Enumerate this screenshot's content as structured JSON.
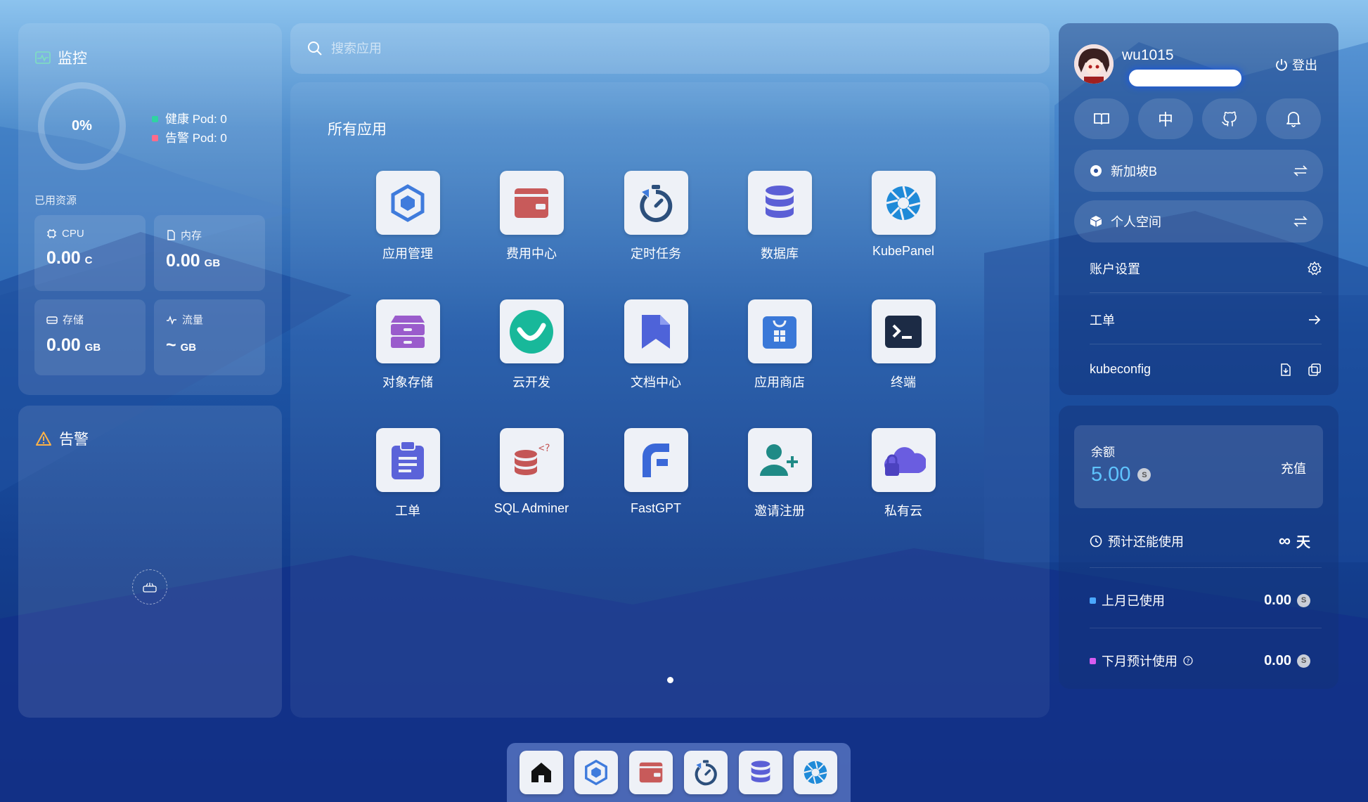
{
  "monitor": {
    "title": "监控",
    "percent": "0%",
    "healthy_pods": "健康 Pod: 0",
    "alert_pods": "告警 Pod: 0",
    "used_resources_label": "已用资源",
    "cpu": {
      "label": "CPU",
      "value": "0.00",
      "unit": "C"
    },
    "memory": {
      "label": "内存",
      "value": "0.00",
      "unit": "GB"
    },
    "storage": {
      "label": "存储",
      "value": "0.00",
      "unit": "GB"
    },
    "traffic": {
      "label": "流量",
      "value": "~",
      "unit": "GB"
    }
  },
  "alerts": {
    "title": "告警"
  },
  "search": {
    "placeholder": "搜索应用"
  },
  "apps": {
    "title": "所有应用",
    "items": [
      {
        "label": "应用管理",
        "icon": "app-management-icon"
      },
      {
        "label": "费用中心",
        "icon": "wallet-icon"
      },
      {
        "label": "定时任务",
        "icon": "timer-icon"
      },
      {
        "label": "数据库",
        "icon": "database-icon"
      },
      {
        "label": "KubePanel",
        "icon": "aperture-icon"
      },
      {
        "label": "对象存储",
        "icon": "storage-cabinet-icon"
      },
      {
        "label": "云开发",
        "icon": "cloud-dev-icon"
      },
      {
        "label": "文档中心",
        "icon": "bookmark-doc-icon"
      },
      {
        "label": "应用商店",
        "icon": "store-bag-icon"
      },
      {
        "label": "终端",
        "icon": "terminal-icon"
      },
      {
        "label": "工单",
        "icon": "clipboard-icon"
      },
      {
        "label": "SQL Adminer",
        "icon": "sql-adminer-icon"
      },
      {
        "label": "FastGPT",
        "icon": "fastgpt-icon"
      },
      {
        "label": "邀请注册",
        "icon": "invite-user-icon"
      },
      {
        "label": "私有云",
        "icon": "private-cloud-icon"
      }
    ]
  },
  "user": {
    "name": "wu1015",
    "logout": "登出",
    "quick_lang": "中",
    "region": "新加坡B",
    "workspace": "个人空间",
    "account_settings": "账户设置",
    "ticket": "工单",
    "kubeconfig": "kubeconfig"
  },
  "balance": {
    "label": "余额",
    "value": "5.00",
    "recharge": "充值",
    "estimate_label": "预计还能使用",
    "estimate_value": "∞",
    "estimate_unit": "天",
    "last_month_label": "上月已使用",
    "last_month_value": "0.00",
    "next_month_label": "下月预计使用",
    "next_month_value": "0.00"
  },
  "colors": {
    "healthy": "#2fd3a2",
    "alert": "#ff6b8a",
    "balance": "#5fc4ff",
    "last_month": "#4aa8ff",
    "next_month": "#d65cf0"
  }
}
